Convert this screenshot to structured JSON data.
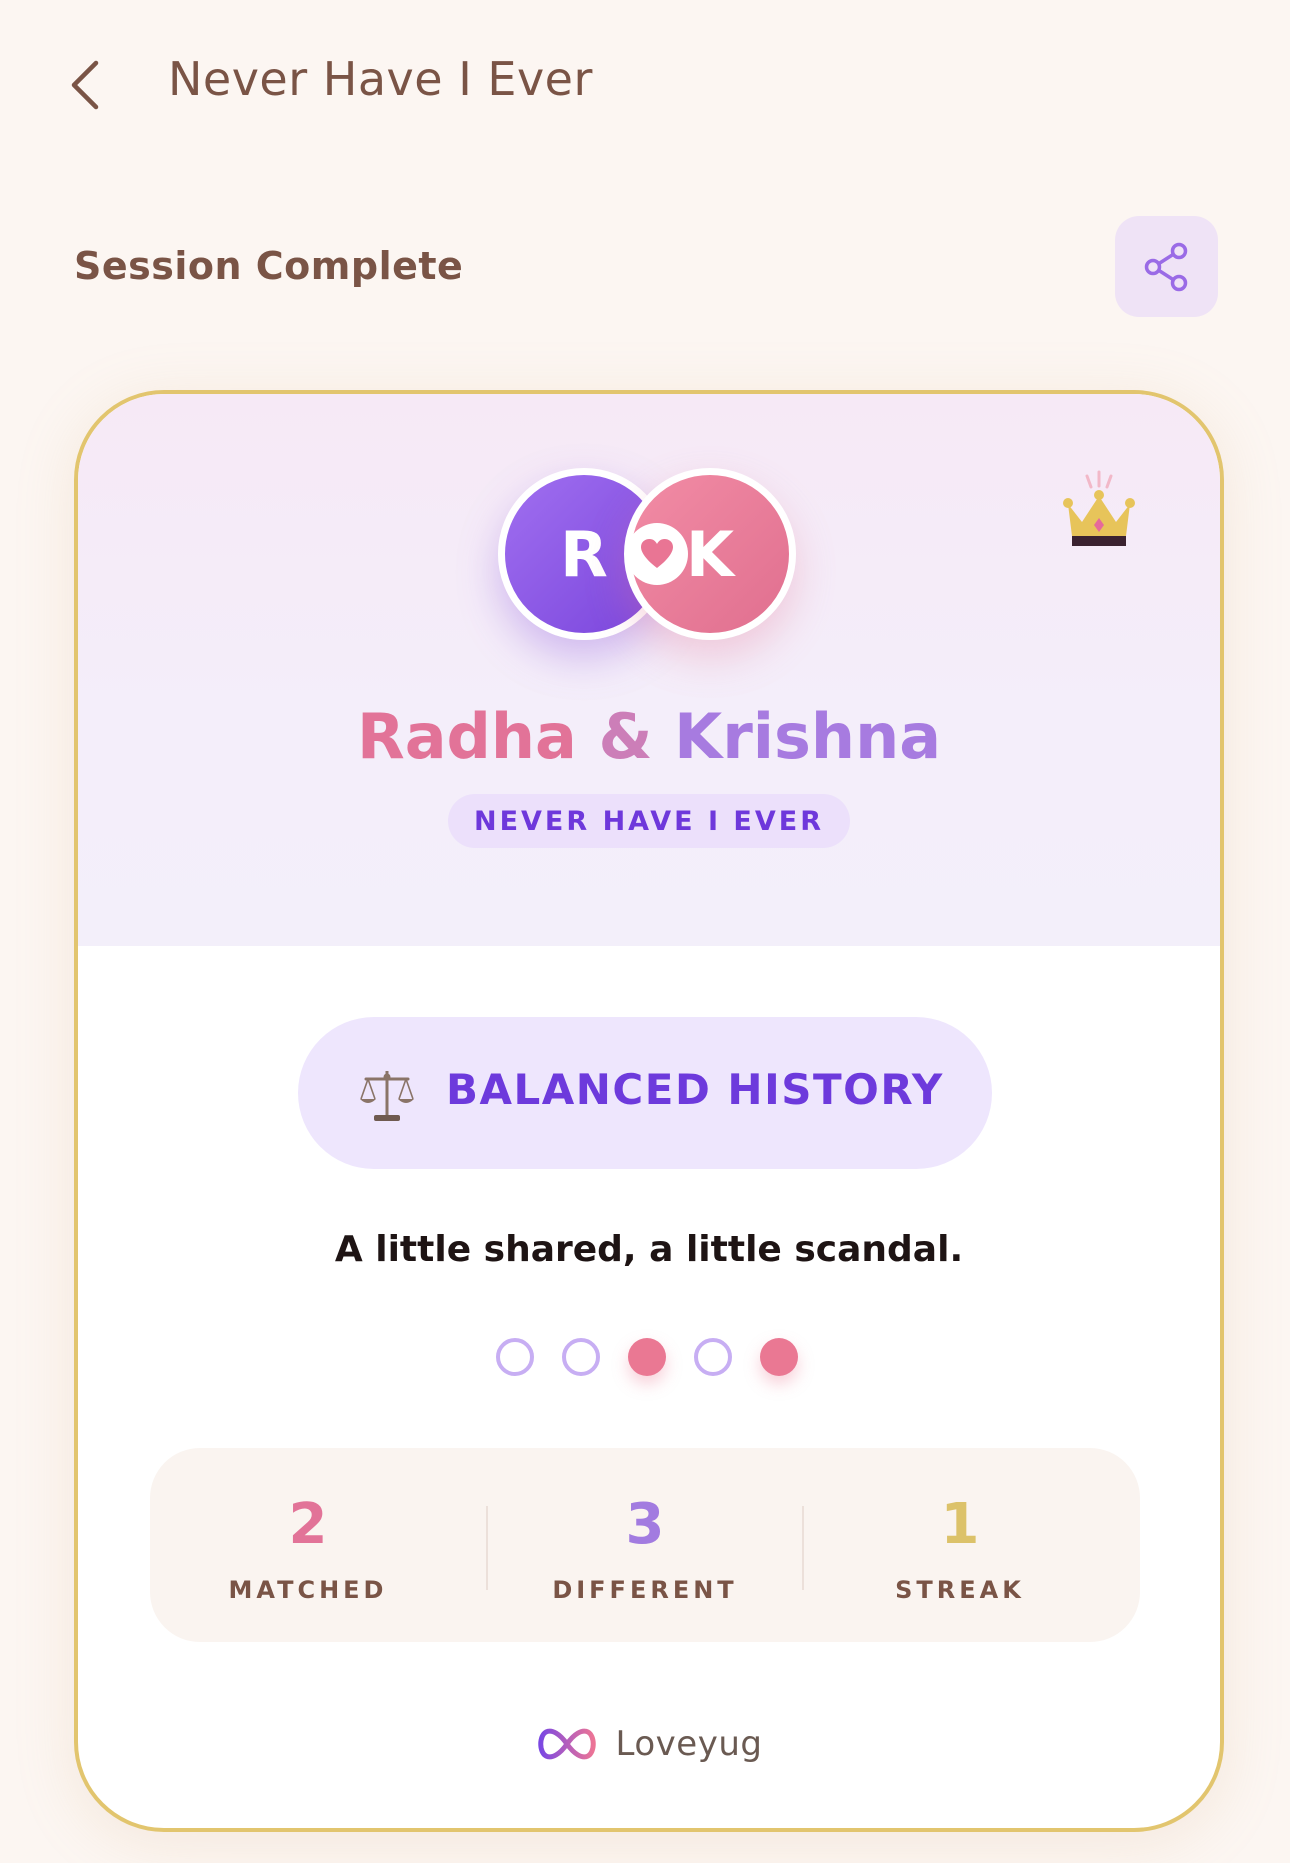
{
  "header": {
    "title": "Never Have I Ever",
    "back_icon": "chevron-left-icon"
  },
  "session": {
    "label": "Session Complete",
    "share_icon": "share-icon"
  },
  "card": {
    "avatars": [
      {
        "initial": "R",
        "color": "#8a5be6"
      },
      {
        "initial": "K",
        "color": "#e8809b"
      }
    ],
    "crown_icon": "crown-icon",
    "couple": {
      "name_a": "Radha",
      "amp": "&",
      "name_b": "Krishna"
    },
    "game_badge": "NEVER HAVE I EVER",
    "result": {
      "icon": "balance-scale-icon",
      "label": "BALANCED HISTORY"
    },
    "tagline": "A little shared, a little scandal.",
    "rounds": [
      "different",
      "different",
      "matched",
      "different",
      "matched"
    ],
    "stats": [
      {
        "value": "2",
        "label": "MATCHED",
        "color": "#e27398"
      },
      {
        "value": "3",
        "label": "DIFFERENT",
        "color": "#a27be0"
      },
      {
        "value": "1",
        "label": "STREAK",
        "color": "#dcc26a"
      }
    ],
    "brand": {
      "name": "Loveyug",
      "logo_icon": "infinity-heart-icon"
    }
  }
}
